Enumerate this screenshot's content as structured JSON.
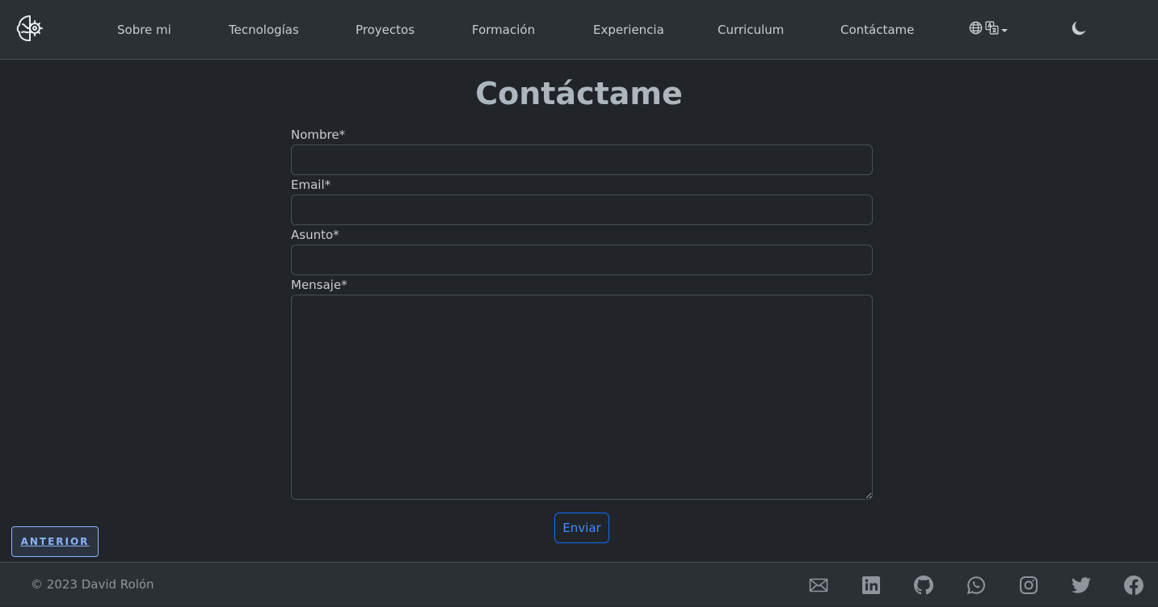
{
  "nav": {
    "items": [
      {
        "label": "Sobre mi"
      },
      {
        "label": "Tecnologías"
      },
      {
        "label": "Proyectos"
      },
      {
        "label": "Formación"
      },
      {
        "label": "Experiencia"
      },
      {
        "label": "Curriculum"
      },
      {
        "label": "Contáctame"
      }
    ],
    "language_icon": "globe-icon",
    "translate_icon": "translate-icon",
    "theme_icon": "moon-icon",
    "logo_icon": "brain-logo-icon"
  },
  "main": {
    "title": "Contáctame",
    "form": {
      "name_label": "Nombre*",
      "name_value": "",
      "email_label": "Email*",
      "email_value": "",
      "subject_label": "Asunto*",
      "subject_value": "",
      "message_label": "Mensaje*",
      "message_value": "",
      "submit_label": "Enviar"
    },
    "prev_label": "ANTERIOR"
  },
  "footer": {
    "copyright": "© 2023 David Rolón",
    "social_icons": [
      "mail-icon",
      "linkedin-icon",
      "github-icon",
      "whatsapp-icon",
      "instagram-icon",
      "twitter-icon",
      "facebook-icon"
    ]
  },
  "colors": {
    "background": "#212529",
    "navbar": "#2b3035",
    "accent": "#0d6efd",
    "prev_accent": "#8ab4f8"
  }
}
